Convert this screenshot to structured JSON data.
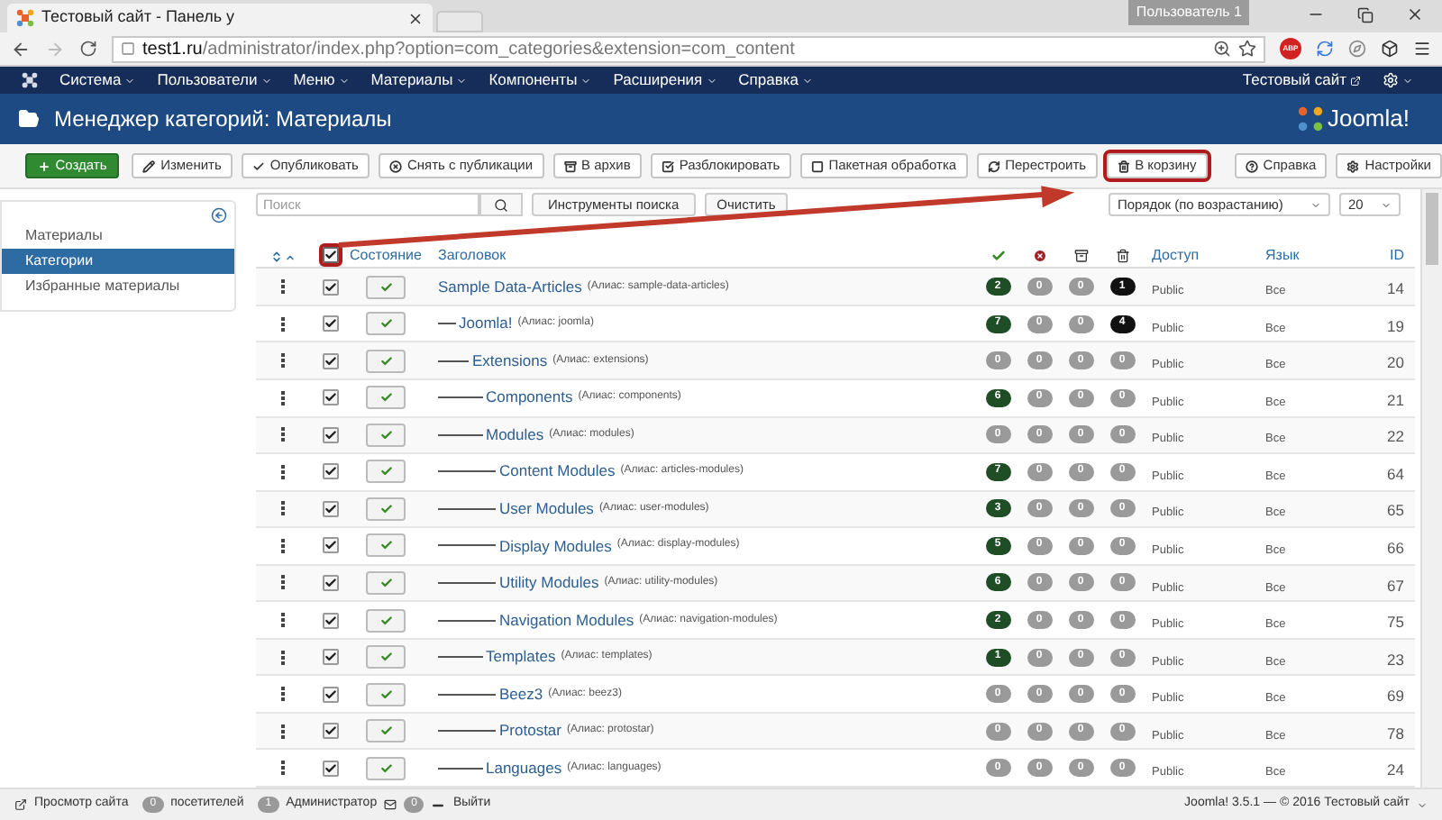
{
  "browser": {
    "tab_title": "Тестовый сайт - Панель у",
    "profile": "Пользователь 1",
    "url_host": "test1.ru",
    "url_path": "/administrator/index.php?option=com_categories&extension=com_content",
    "extension_badge": "ABP"
  },
  "navbar": {
    "menu": [
      "Система",
      "Пользователи",
      "Меню",
      "Материалы",
      "Компоненты",
      "Расширения",
      "Справка"
    ],
    "site_link": "Тестовый сайт"
  },
  "header": {
    "title": "Менеджер категорий: Материалы",
    "logo": "Joomla!"
  },
  "toolbar": [
    {
      "label": "Создать",
      "kind": "primary",
      "highlighted": false
    },
    {
      "label": "Изменить",
      "kind": "default",
      "highlighted": false
    },
    {
      "label": "Опубликовать",
      "kind": "default",
      "highlighted": false
    },
    {
      "label": "Снять с публикации",
      "kind": "default",
      "highlighted": false
    },
    {
      "label": "В архив",
      "kind": "default",
      "highlighted": false
    },
    {
      "label": "Разблокировать",
      "kind": "default",
      "highlighted": false
    },
    {
      "label": "Пакетная обработка",
      "kind": "default",
      "highlighted": false
    },
    {
      "label": "Перестроить",
      "kind": "default",
      "highlighted": false
    },
    {
      "label": "В корзину",
      "kind": "default",
      "highlighted": true
    },
    {
      "label": "Справка",
      "kind": "default",
      "highlighted": false
    },
    {
      "label": "Настройки",
      "kind": "default",
      "highlighted": false
    }
  ],
  "sidebar": {
    "items": [
      {
        "label": "Материалы",
        "selected": false
      },
      {
        "label": "Категории",
        "selected": true
      },
      {
        "label": "Избранные материалы",
        "selected": false
      }
    ]
  },
  "filters": {
    "search_placeholder": "Поиск",
    "tools_button": "Инструменты поиска",
    "clear_button": "Очистить",
    "ordering": "Порядок (по возрастанию)",
    "limit": "20"
  },
  "table": {
    "select_all": {
      "checked": true,
      "highlighted": true
    },
    "columns": [
      "Состояние",
      "Заголовок",
      "Доступ",
      "Язык",
      "ID"
    ],
    "rows": [
      {
        "title": "Sample Data-Articles",
        "alias": "(Алиас: sample-data-articles)",
        "checked": true,
        "published": true,
        "counts": [
          {
            "value": "2",
            "color": "#1e4d26"
          },
          {
            "value": "0",
            "color": "#9a9a9a"
          },
          {
            "value": "0",
            "color": "#9a9a9a"
          },
          {
            "value": "1",
            "color": "#111111"
          }
        ],
        "access": "Public",
        "language": "Все",
        "id": "14",
        "children": [
          {
            "title": "Joomla!",
            "alias": "(Алиас: joomla)",
            "checked": true,
            "published": true,
            "counts": [
              {
                "value": "7",
                "color": "#1e4d26"
              },
              {
                "value": "0",
                "color": "#9a9a9a"
              },
              {
                "value": "0",
                "color": "#9a9a9a"
              },
              {
                "value": "4",
                "color": "#111111"
              }
            ],
            "access": "Public",
            "language": "Все",
            "id": "19",
            "children": [
              {
                "title": "Extensions",
                "alias": "(Алиас: extensions)",
                "checked": true,
                "published": true,
                "counts": [
                  {
                    "value": "0",
                    "color": "#9a9a9a"
                  },
                  {
                    "value": "0",
                    "color": "#9a9a9a"
                  },
                  {
                    "value": "0",
                    "color": "#9a9a9a"
                  },
                  {
                    "value": "0",
                    "color": "#9a9a9a"
                  }
                ],
                "access": "Public",
                "language": "Все",
                "id": "20",
                "children": [
                  {
                    "title": "Components",
                    "alias": "(Алиас: components)",
                    "checked": true,
                    "published": true,
                    "counts": [
                      {
                        "value": "6",
                        "color": "#1e4d26"
                      },
                      {
                        "value": "0",
                        "color": "#9a9a9a"
                      },
                      {
                        "value": "0",
                        "color": "#9a9a9a"
                      },
                      {
                        "value": "0",
                        "color": "#9a9a9a"
                      }
                    ],
                    "access": "Public",
                    "language": "Все",
                    "id": "21"
                  },
                  {
                    "title": "Modules",
                    "alias": "(Алиас: modules)",
                    "checked": true,
                    "published": true,
                    "counts": [
                      {
                        "value": "0",
                        "color": "#9a9a9a"
                      },
                      {
                        "value": "0",
                        "color": "#9a9a9a"
                      },
                      {
                        "value": "0",
                        "color": "#9a9a9a"
                      },
                      {
                        "value": "0",
                        "color": "#9a9a9a"
                      }
                    ],
                    "access": "Public",
                    "language": "Все",
                    "id": "22",
                    "children": [
                      {
                        "title": "Content Modules",
                        "alias": "(Алиас: articles-modules)",
                        "checked": true,
                        "published": true,
                        "counts": [
                          {
                            "value": "7",
                            "color": "#1e4d26"
                          },
                          {
                            "value": "0",
                            "color": "#9a9a9a"
                          },
                          {
                            "value": "0",
                            "color": "#9a9a9a"
                          },
                          {
                            "value": "0",
                            "color": "#9a9a9a"
                          }
                        ],
                        "access": "Public",
                        "language": "Все",
                        "id": "64"
                      },
                      {
                        "title": "User Modules",
                        "alias": "(Алиас: user-modules)",
                        "checked": true,
                        "published": true,
                        "counts": [
                          {
                            "value": "3",
                            "color": "#1e4d26"
                          },
                          {
                            "value": "0",
                            "color": "#9a9a9a"
                          },
                          {
                            "value": "0",
                            "color": "#9a9a9a"
                          },
                          {
                            "value": "0",
                            "color": "#9a9a9a"
                          }
                        ],
                        "access": "Public",
                        "language": "Все",
                        "id": "65"
                      },
                      {
                        "title": "Display Modules",
                        "alias": "(Алиас: display-modules)",
                        "checked": true,
                        "published": true,
                        "counts": [
                          {
                            "value": "5",
                            "color": "#1e4d26"
                          },
                          {
                            "value": "0",
                            "color": "#9a9a9a"
                          },
                          {
                            "value": "0",
                            "color": "#9a9a9a"
                          },
                          {
                            "value": "0",
                            "color": "#9a9a9a"
                          }
                        ],
                        "access": "Public",
                        "language": "Все",
                        "id": "66"
                      },
                      {
                        "title": "Utility Modules",
                        "alias": "(Алиас: utility-modules)",
                        "checked": true,
                        "published": true,
                        "counts": [
                          {
                            "value": "6",
                            "color": "#1e4d26"
                          },
                          {
                            "value": "0",
                            "color": "#9a9a9a"
                          },
                          {
                            "value": "0",
                            "color": "#9a9a9a"
                          },
                          {
                            "value": "0",
                            "color": "#9a9a9a"
                          }
                        ],
                        "access": "Public",
                        "language": "Все",
                        "id": "67"
                      },
                      {
                        "title": "Navigation Modules",
                        "alias": "(Алиас: navigation-modules)",
                        "checked": true,
                        "published": true,
                        "counts": [
                          {
                            "value": "2",
                            "color": "#1e4d26"
                          },
                          {
                            "value": "0",
                            "color": "#9a9a9a"
                          },
                          {
                            "value": "0",
                            "color": "#9a9a9a"
                          },
                          {
                            "value": "0",
                            "color": "#9a9a9a"
                          }
                        ],
                        "access": "Public",
                        "language": "Все",
                        "id": "75"
                      }
                    ]
                  },
                  {
                    "title": "Templates",
                    "alias": "(Алиас: templates)",
                    "checked": true,
                    "published": true,
                    "counts": [
                      {
                        "value": "1",
                        "color": "#1e4d26"
                      },
                      {
                        "value": "0",
                        "color": "#9a9a9a"
                      },
                      {
                        "value": "0",
                        "color": "#9a9a9a"
                      },
                      {
                        "value": "0",
                        "color": "#9a9a9a"
                      }
                    ],
                    "access": "Public",
                    "language": "Все",
                    "id": "23",
                    "children": [
                      {
                        "title": "Beez3",
                        "alias": "(Алиас: beez3)",
                        "checked": true,
                        "published": true,
                        "counts": [
                          {
                            "value": "0",
                            "color": "#9a9a9a"
                          },
                          {
                            "value": "0",
                            "color": "#9a9a9a"
                          },
                          {
                            "value": "0",
                            "color": "#9a9a9a"
                          },
                          {
                            "value": "0",
                            "color": "#9a9a9a"
                          }
                        ],
                        "access": "Public",
                        "language": "Все",
                        "id": "69"
                      },
                      {
                        "title": "Protostar",
                        "alias": "(Алиас: protostar)",
                        "checked": true,
                        "published": true,
                        "counts": [
                          {
                            "value": "0",
                            "color": "#9a9a9a"
                          },
                          {
                            "value": "0",
                            "color": "#9a9a9a"
                          },
                          {
                            "value": "0",
                            "color": "#9a9a9a"
                          },
                          {
                            "value": "0",
                            "color": "#9a9a9a"
                          }
                        ],
                        "access": "Public",
                        "language": "Все",
                        "id": "78"
                      }
                    ]
                  },
                  {
                    "title": "Languages",
                    "alias": "(Алиас: languages)",
                    "checked": true,
                    "published": true,
                    "counts": [
                      {
                        "value": "0",
                        "color": "#9a9a9a"
                      },
                      {
                        "value": "0",
                        "color": "#9a9a9a"
                      },
                      {
                        "value": "0",
                        "color": "#9a9a9a"
                      },
                      {
                        "value": "0",
                        "color": "#9a9a9a"
                      }
                    ],
                    "access": "Public",
                    "language": "Все",
                    "id": "24"
                  }
                ]
              }
            ]
          }
        ]
      }
    ]
  },
  "status_bar": {
    "view_site": "Просмотр сайта",
    "visitors_count": "0",
    "visitors_label": "посетителей",
    "admins_count": "1",
    "admins_label": "Администратор",
    "messages_count": "0",
    "logout": "Выйти",
    "copyright": "Joomla! 3.5.1 — © 2016 Тестовый сайт"
  }
}
